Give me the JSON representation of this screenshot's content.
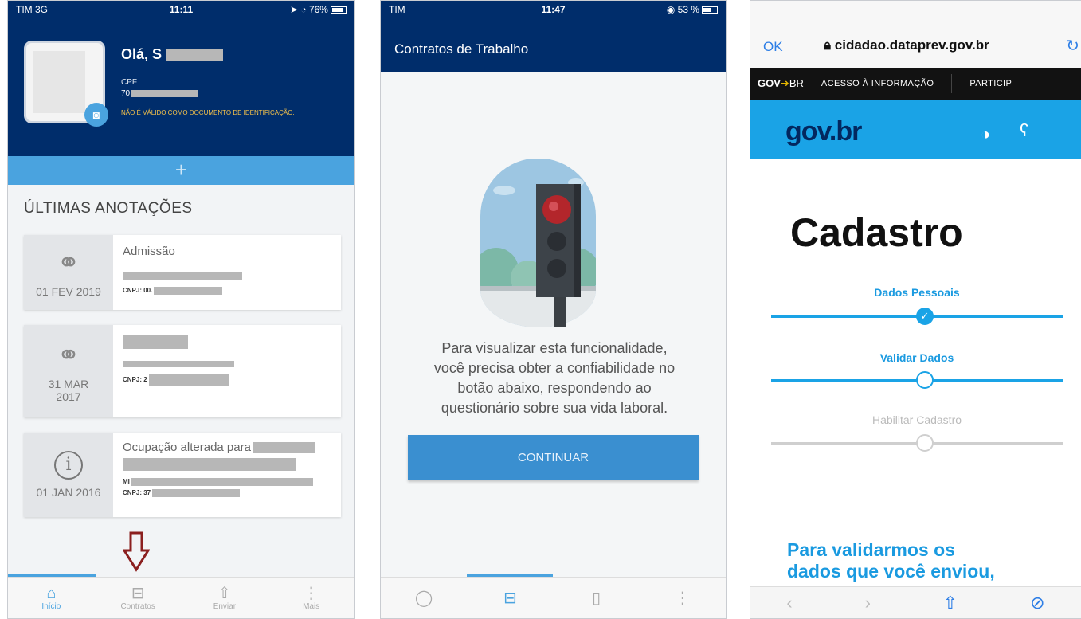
{
  "phone1": {
    "status": {
      "carrier": "TIM  3G",
      "time": "11:11",
      "battery": "76%"
    },
    "greeting": "Olá, S",
    "cpf_label": "CPF",
    "cpf_value": "70",
    "not_valid": "NÃO É VÁLIDO COMO DOCUMENTO DE IDENTIFICAÇÃO.",
    "add_symbol": "+",
    "section_title": "ÚLTIMAS ANOTAÇÕES",
    "cards": [
      {
        "date": "01 FEV 2019",
        "title": "Admissão",
        "cnpj": "CNPJ: 00."
      },
      {
        "date": "31 MAR 2017",
        "title": "",
        "cnpj": "CNPJ: 2"
      },
      {
        "date": "01 JAN 2016",
        "title": "Ocupação alterada para",
        "sub": "MI",
        "cnpj": "CNPJ: 37"
      }
    ],
    "tabs": [
      {
        "label": "Início",
        "icon": "home-icon"
      },
      {
        "label": "Contratos",
        "icon": "briefcase-icon"
      },
      {
        "label": "Enviar",
        "icon": "share-icon"
      },
      {
        "label": "Mais",
        "icon": "more-icon"
      }
    ],
    "accent": "#4aa3df",
    "header_color": "#002d6b"
  },
  "phone2": {
    "status": {
      "carrier": "TIM",
      "time": "11:47",
      "battery": "53 %"
    },
    "title": "Contratos de Trabalho",
    "message_lines": [
      "Para visualizar esta funcionalidade,",
      "você precisa obter a confiabilidade no",
      "botão abaixo, respondendo ao",
      "questionário sobre sua vida laboral."
    ],
    "continue_label": "CONTINUAR"
  },
  "phone3": {
    "ok_label": "OK",
    "url": "cidadao.dataprev.gov.br",
    "govbr_bar": {
      "brand": "GOV",
      "brand_suffix": "BR",
      "access": "ACESSO À INFORMAÇÃO",
      "particip": "PARTICIP"
    },
    "logo": "gov.br",
    "page_title": "Cadastro",
    "steps": [
      {
        "label": "Dados Pessoais",
        "state": "done"
      },
      {
        "label": "Validar Dados",
        "state": "current"
      },
      {
        "label": "Habilitar Cadastro",
        "state": "pending"
      }
    ],
    "bottom_lines": [
      "Para validarmos os",
      "dados que você enviou,"
    ],
    "step_color": "#1aa3e6"
  }
}
